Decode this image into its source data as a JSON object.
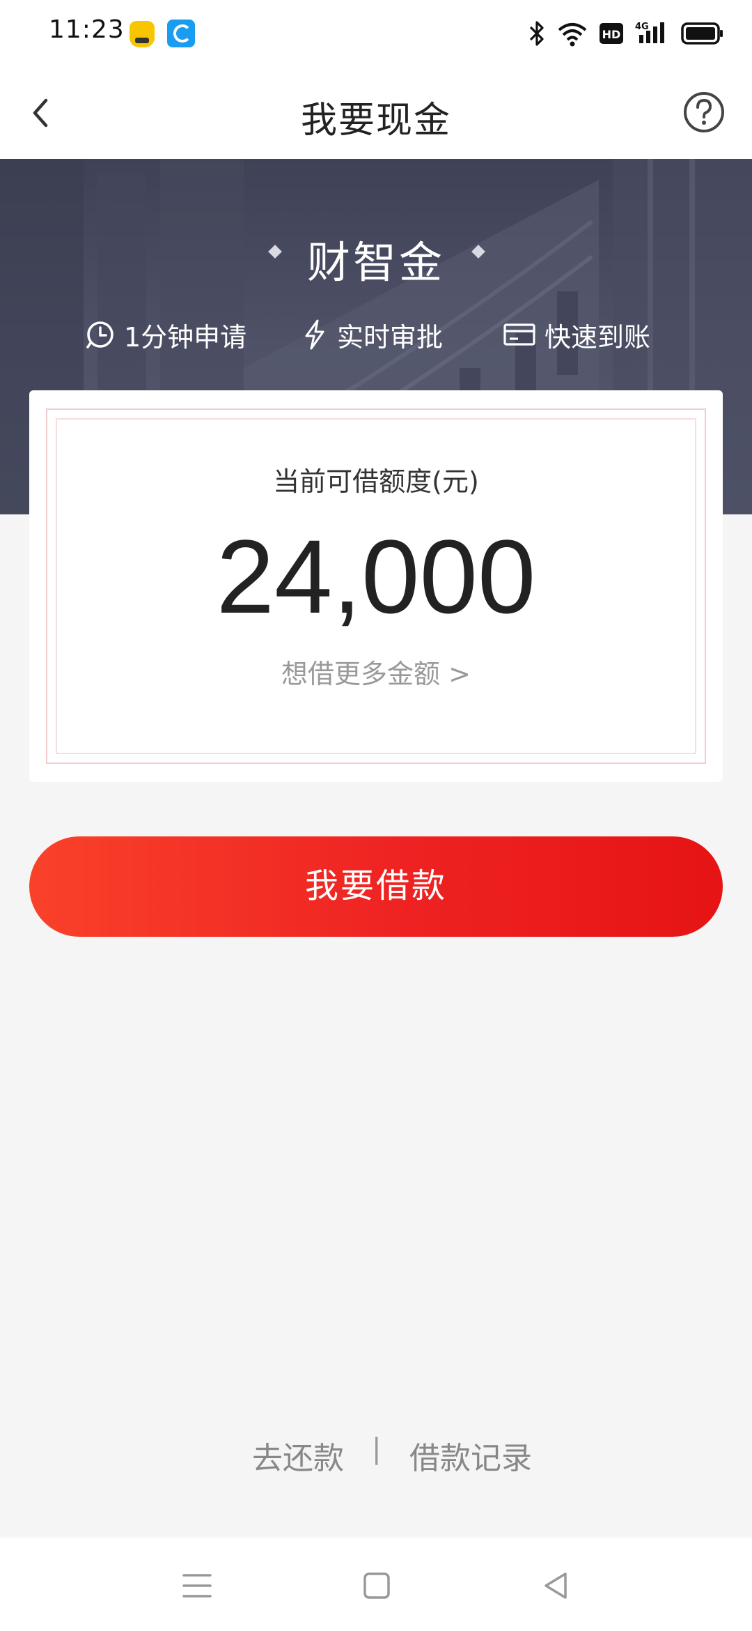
{
  "status_bar": {
    "time": "11:23"
  },
  "nav": {
    "title": "我要现金"
  },
  "banner": {
    "product_name": "财智金",
    "features": [
      {
        "icon": "clock-icon",
        "label": "1分钟申请"
      },
      {
        "icon": "lightning-icon",
        "label": "实时审批"
      },
      {
        "icon": "card-icon",
        "label": "快速到账"
      }
    ]
  },
  "credit_card": {
    "label": "当前可借额度(元)",
    "amount": "24,000",
    "more_link": "想借更多金额 >"
  },
  "actions": {
    "borrow_label": "我要借款"
  },
  "bottom_links": {
    "repay": "去还款",
    "separator": "|",
    "records": "借款记录"
  },
  "colors": {
    "accent_red": "#ee2222",
    "banner_bg": "#4a4d62"
  }
}
